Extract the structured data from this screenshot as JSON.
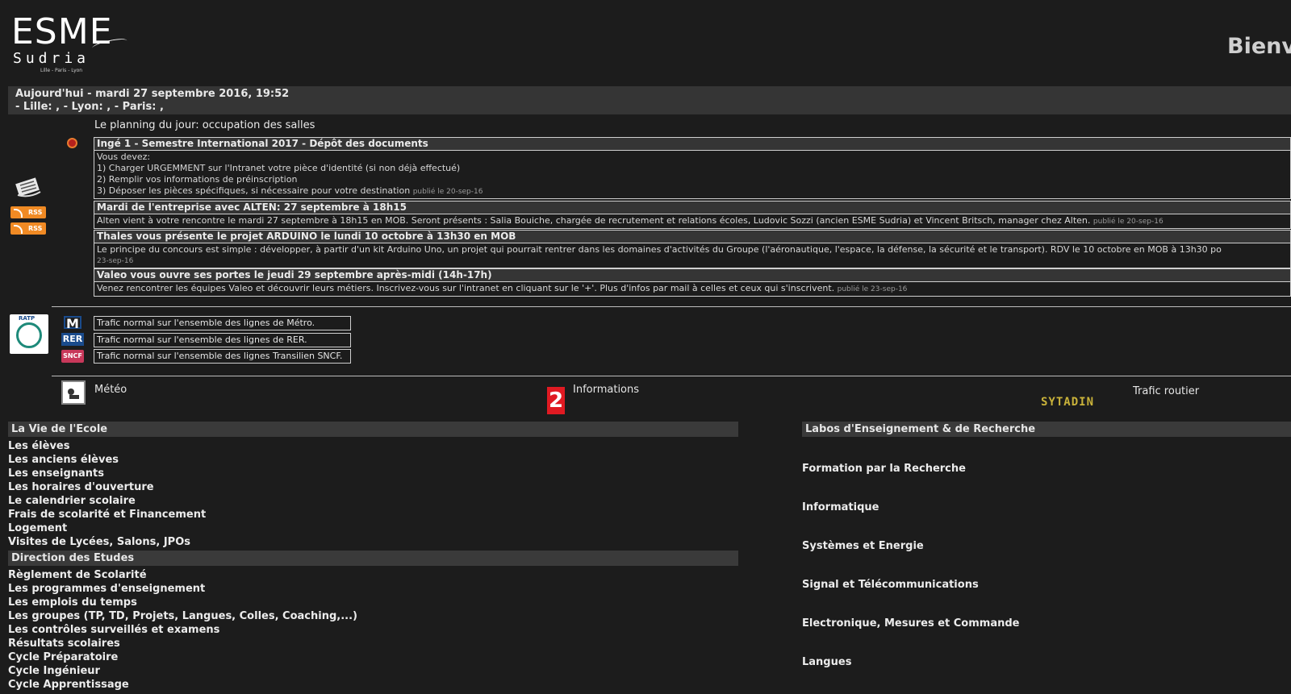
{
  "header": {
    "logo_main": "ESME",
    "logo_sub": "Sudria",
    "logo_cities": "Lille - Paris - Lyon",
    "welcome": "Bienv"
  },
  "today": {
    "line1": "Aujourd'hui - mardi 27 septembre 2016, 19:52",
    "line2": "- Lille: , - Lyon: , - Paris: ,"
  },
  "planning": {
    "title": "Le planning du jour: occupation des salles",
    "rss_label": "RSS"
  },
  "news": [
    {
      "title": "Ingé 1 - Semestre International 2017 - Dépôt des documents",
      "lines": [
        "Vous devez:",
        "1) Charger URGEMMENT sur l'Intranet votre pièce d'identité (si non déjà effectué)",
        "2) Remplir vos informations de préinscription",
        "3) Déposer les pièces spécifiques, si nécessaire pour votre destination"
      ],
      "published": "publié le 20-sep-16"
    },
    {
      "title": "Mardi de l'entreprise avec ALTEN: 27 septembre à 18h15",
      "lines": [
        "Alten vient à votre rencontre le mardi 27 septembre à 18h15 en MOB. Seront présents : Salia Bouiche, chargée de recrutement et relations écoles, Ludovic Sozzi (ancien ESME Sudria) et Vincent Britsch, manager chez Alten."
      ],
      "published": "publié le 20-sep-16"
    },
    {
      "title": "Thales vous présente le projet ARDUINO le lundi 10 octobre à 13h30 en MOB",
      "lines": [
        "Le principe du concours est simple : développer, à partir d'un kit Arduino Uno, un projet qui pourrait rentrer dans les domaines d'activités du Groupe (l'aéronautique, l'espace, la défense, la sécurité et le transport). RDV le 10 octobre en MOB à 13h30 po"
      ],
      "published": "23-sep-16"
    },
    {
      "title": "Valeo vous ouvre ses portes le jeudi 29 septembre après-midi (14h-17h)",
      "lines": [
        "Venez rencontrer les équipes Valeo et découvrir leurs métiers. Inscrivez-vous sur l'intranet en cliquant sur le '+'. Plus d'infos par mail à celles et ceux qui s'inscrivent."
      ],
      "published": "publié le 23-sep-16"
    }
  ],
  "transport": {
    "ratp_label": "RATP",
    "metro_icon": "M",
    "rer_icon": "RER",
    "sncf_icon": "SNCF",
    "metro": "Trafic normal sur l'ensemble des lignes de Métro.",
    "rer": "Trafic normal sur l'ensemble des lignes de RER.",
    "sncf": "Trafic normal sur l'ensemble des lignes Transilien SNCF."
  },
  "infos": {
    "meteo": "Météo",
    "f2_icon": "2",
    "informations": "Informations",
    "sytadin": "SYTADIN",
    "trafic_routier": "Trafic routier"
  },
  "vie_ecole": {
    "header": "La Vie de l'Ecole",
    "links": [
      "Les élèves",
      "Les anciens élèves",
      "Les enseignants",
      "Les horaires d'ouverture",
      "Le calendrier scolaire",
      "Frais de scolarité et Financement",
      "Logement",
      "Visites de Lycées, Salons, JPOs"
    ]
  },
  "direction_etudes": {
    "header": "Direction des Etudes",
    "links": [
      "Règlement de Scolarité",
      "Les programmes d'enseignement",
      "Les emplois du temps",
      "Les groupes (TP, TD, Projets, Langues, Colles, Coaching,...)",
      "Les contrôles surveillés et examens",
      "Résultats scolaires",
      "Cycle Préparatoire",
      "Cycle Ingénieur",
      "Cycle Apprentissage"
    ]
  },
  "labos": {
    "header": "Labos d'Enseignement & de Recherche",
    "links": [
      "Formation par la Recherche",
      "Informatique",
      "Systèmes et Energie",
      "Signal et Télécommunications",
      "Electronique, Mesures et Commande",
      "Langues"
    ]
  },
  "colors": {
    "background": "#1c1c1c",
    "bar": "#353535",
    "rss": "#f08a24",
    "france2_red": "#e01a22",
    "sytadin": "#c9b23a"
  }
}
